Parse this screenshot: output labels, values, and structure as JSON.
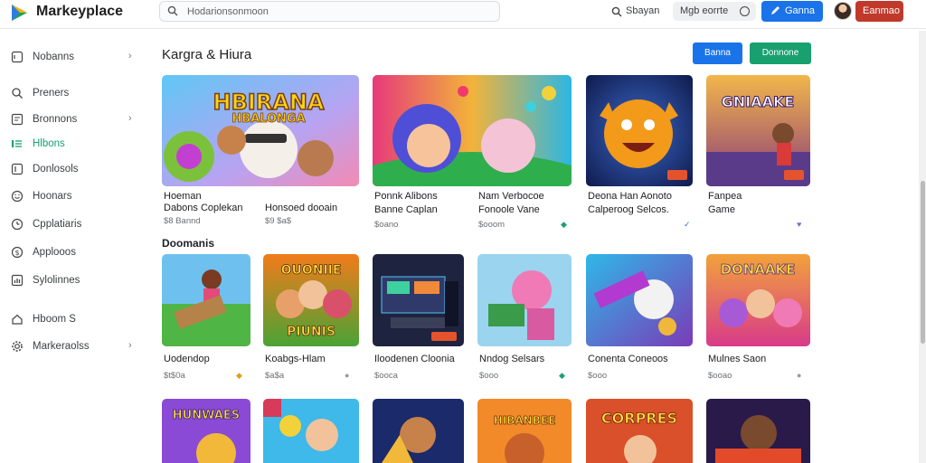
{
  "header": {
    "brand": "Markeyplace",
    "search_placeholder": "Hodarionsonmoon",
    "search_link": "Sbayan",
    "pill_label": "Mgb eorrte",
    "blue_button": "Ganna",
    "red_button": "Eanmao",
    "colors": {
      "blue": "#1a73e8",
      "red": "#c0392b",
      "green": "#18a06e"
    }
  },
  "sidebar": {
    "items": [
      {
        "label": "Nobanns",
        "icon": "square-icon",
        "chevron": "›"
      },
      {
        "label": "Preners",
        "icon": "search-icon"
      },
      {
        "label": "Bronnons",
        "icon": "grid-icon",
        "chevron": "›"
      },
      {
        "label": "Hlbons",
        "icon": "list-icon",
        "active": true
      },
      {
        "label": "Donlosols",
        "icon": "square-icon"
      },
      {
        "label": "Hoonars",
        "icon": "smile-icon"
      },
      {
        "label": "Cpplatiaris",
        "icon": "clock-icon"
      },
      {
        "label": "Applooos",
        "icon": "dollar-icon"
      },
      {
        "label": "Sylolinnes",
        "icon": "chart-icon"
      },
      {
        "label": "Hboom S",
        "icon": "home-icon"
      },
      {
        "label": "Markeraolss",
        "icon": "gear-icon",
        "chevron": "›"
      }
    ]
  },
  "main": {
    "title": "Kargra & Hiura",
    "blue_button": "Banna",
    "green_button": "Donnone",
    "subsection": "Doomanis",
    "featured": [
      {
        "title1": "Hoeman",
        "title2": "Dabons Coplekan",
        "meta": "$8 Bannd",
        "title1b": "",
        "title2b": "Honsoed dooain",
        "metab": "$9 $a$"
      },
      {
        "title1": "Ponnk Alibons",
        "title2": "Banne Caplan",
        "meta": "$oano",
        "title1b": "Nam Verbocoe",
        "title2b": "Fonoole Vane",
        "metab": "$ooom"
      },
      {
        "title1": "Deona Han Aonoto",
        "title2": "Calperoog Selcos.",
        "meta": ""
      },
      {
        "title1": "Fanpea",
        "title2": "Game",
        "meta": ""
      }
    ],
    "row2": [
      {
        "title": "Uodendop",
        "meta": "$t$0a"
      },
      {
        "title": "Koabgs-Hlam",
        "meta": "$a$a"
      },
      {
        "title": "Iloodenen Cloonia",
        "meta": "$ooca"
      },
      {
        "title": "Nndog Selsars",
        "meta": "$ooo"
      },
      {
        "title": "Conenta Coneoos",
        "meta": "$ooo"
      },
      {
        "title": "Mulnes Saon",
        "meta": "$ooao"
      }
    ],
    "thumb_texts": {
      "t1": "HBIRANA",
      "t1b": "HBALONGA",
      "t4": "GNIAAKE",
      "r1c2": "OUONIIE",
      "r1c2b": "PIUNIS",
      "r1c6": "DONAAKE",
      "r2c1": "HUNWAES",
      "r2c4": "HIBANBEE",
      "r2c5": "CORPRES"
    }
  }
}
